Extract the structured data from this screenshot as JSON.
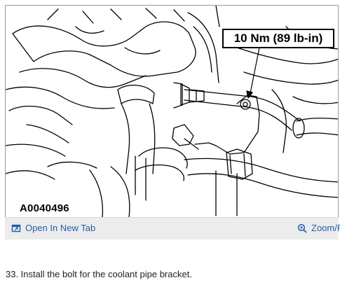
{
  "figure": {
    "callout": "10 Nm (89 lb-in)",
    "figure_id": "A0040496"
  },
  "toolbar": {
    "open_label": "Open In New Tab",
    "open_icon": "open-new-tab-icon",
    "zoom_label": "Zoom/P",
    "zoom_icon": "magnifier-zoom-icon",
    "link_color": "#1f5ea8",
    "background": "#ececec"
  },
  "caption": "33. Install the bolt for the coolant pipe bracket."
}
